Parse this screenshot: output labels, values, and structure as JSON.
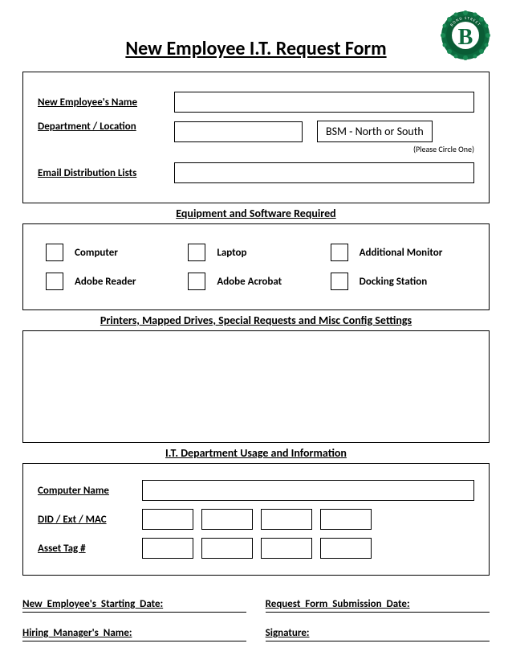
{
  "title": "New Employee I.T. Request Form",
  "section1": {
    "name_label": "New Employee's Name",
    "dept_label": "Department / Location",
    "bsm_text": "BSM - North or South",
    "circle_hint": "(Please Circle One)",
    "email_label": "Email Distribution Lists"
  },
  "equip_heading": "Equipment and Software Required",
  "equipment": [
    "Computer",
    "Laptop",
    "Additional Monitor",
    "Adobe Reader",
    "Adobe Acrobat",
    "Docking Station"
  ],
  "printers_heading": "Printers, Mapped Drives, Special Requests and Misc Config Settings",
  "it_heading": "I.T. Department Usage and Information",
  "it": {
    "computer_label": "Computer Name",
    "did_label": "DID / Ext / MAC",
    "asset_label": "Asset Tag #"
  },
  "bottom": {
    "start_date": "New  Employee's  Starting  Date:",
    "request_date": "Request  Form  Submission  Date:",
    "hiring": "Hiring Manager's Name:",
    "signature": "Signature:"
  }
}
